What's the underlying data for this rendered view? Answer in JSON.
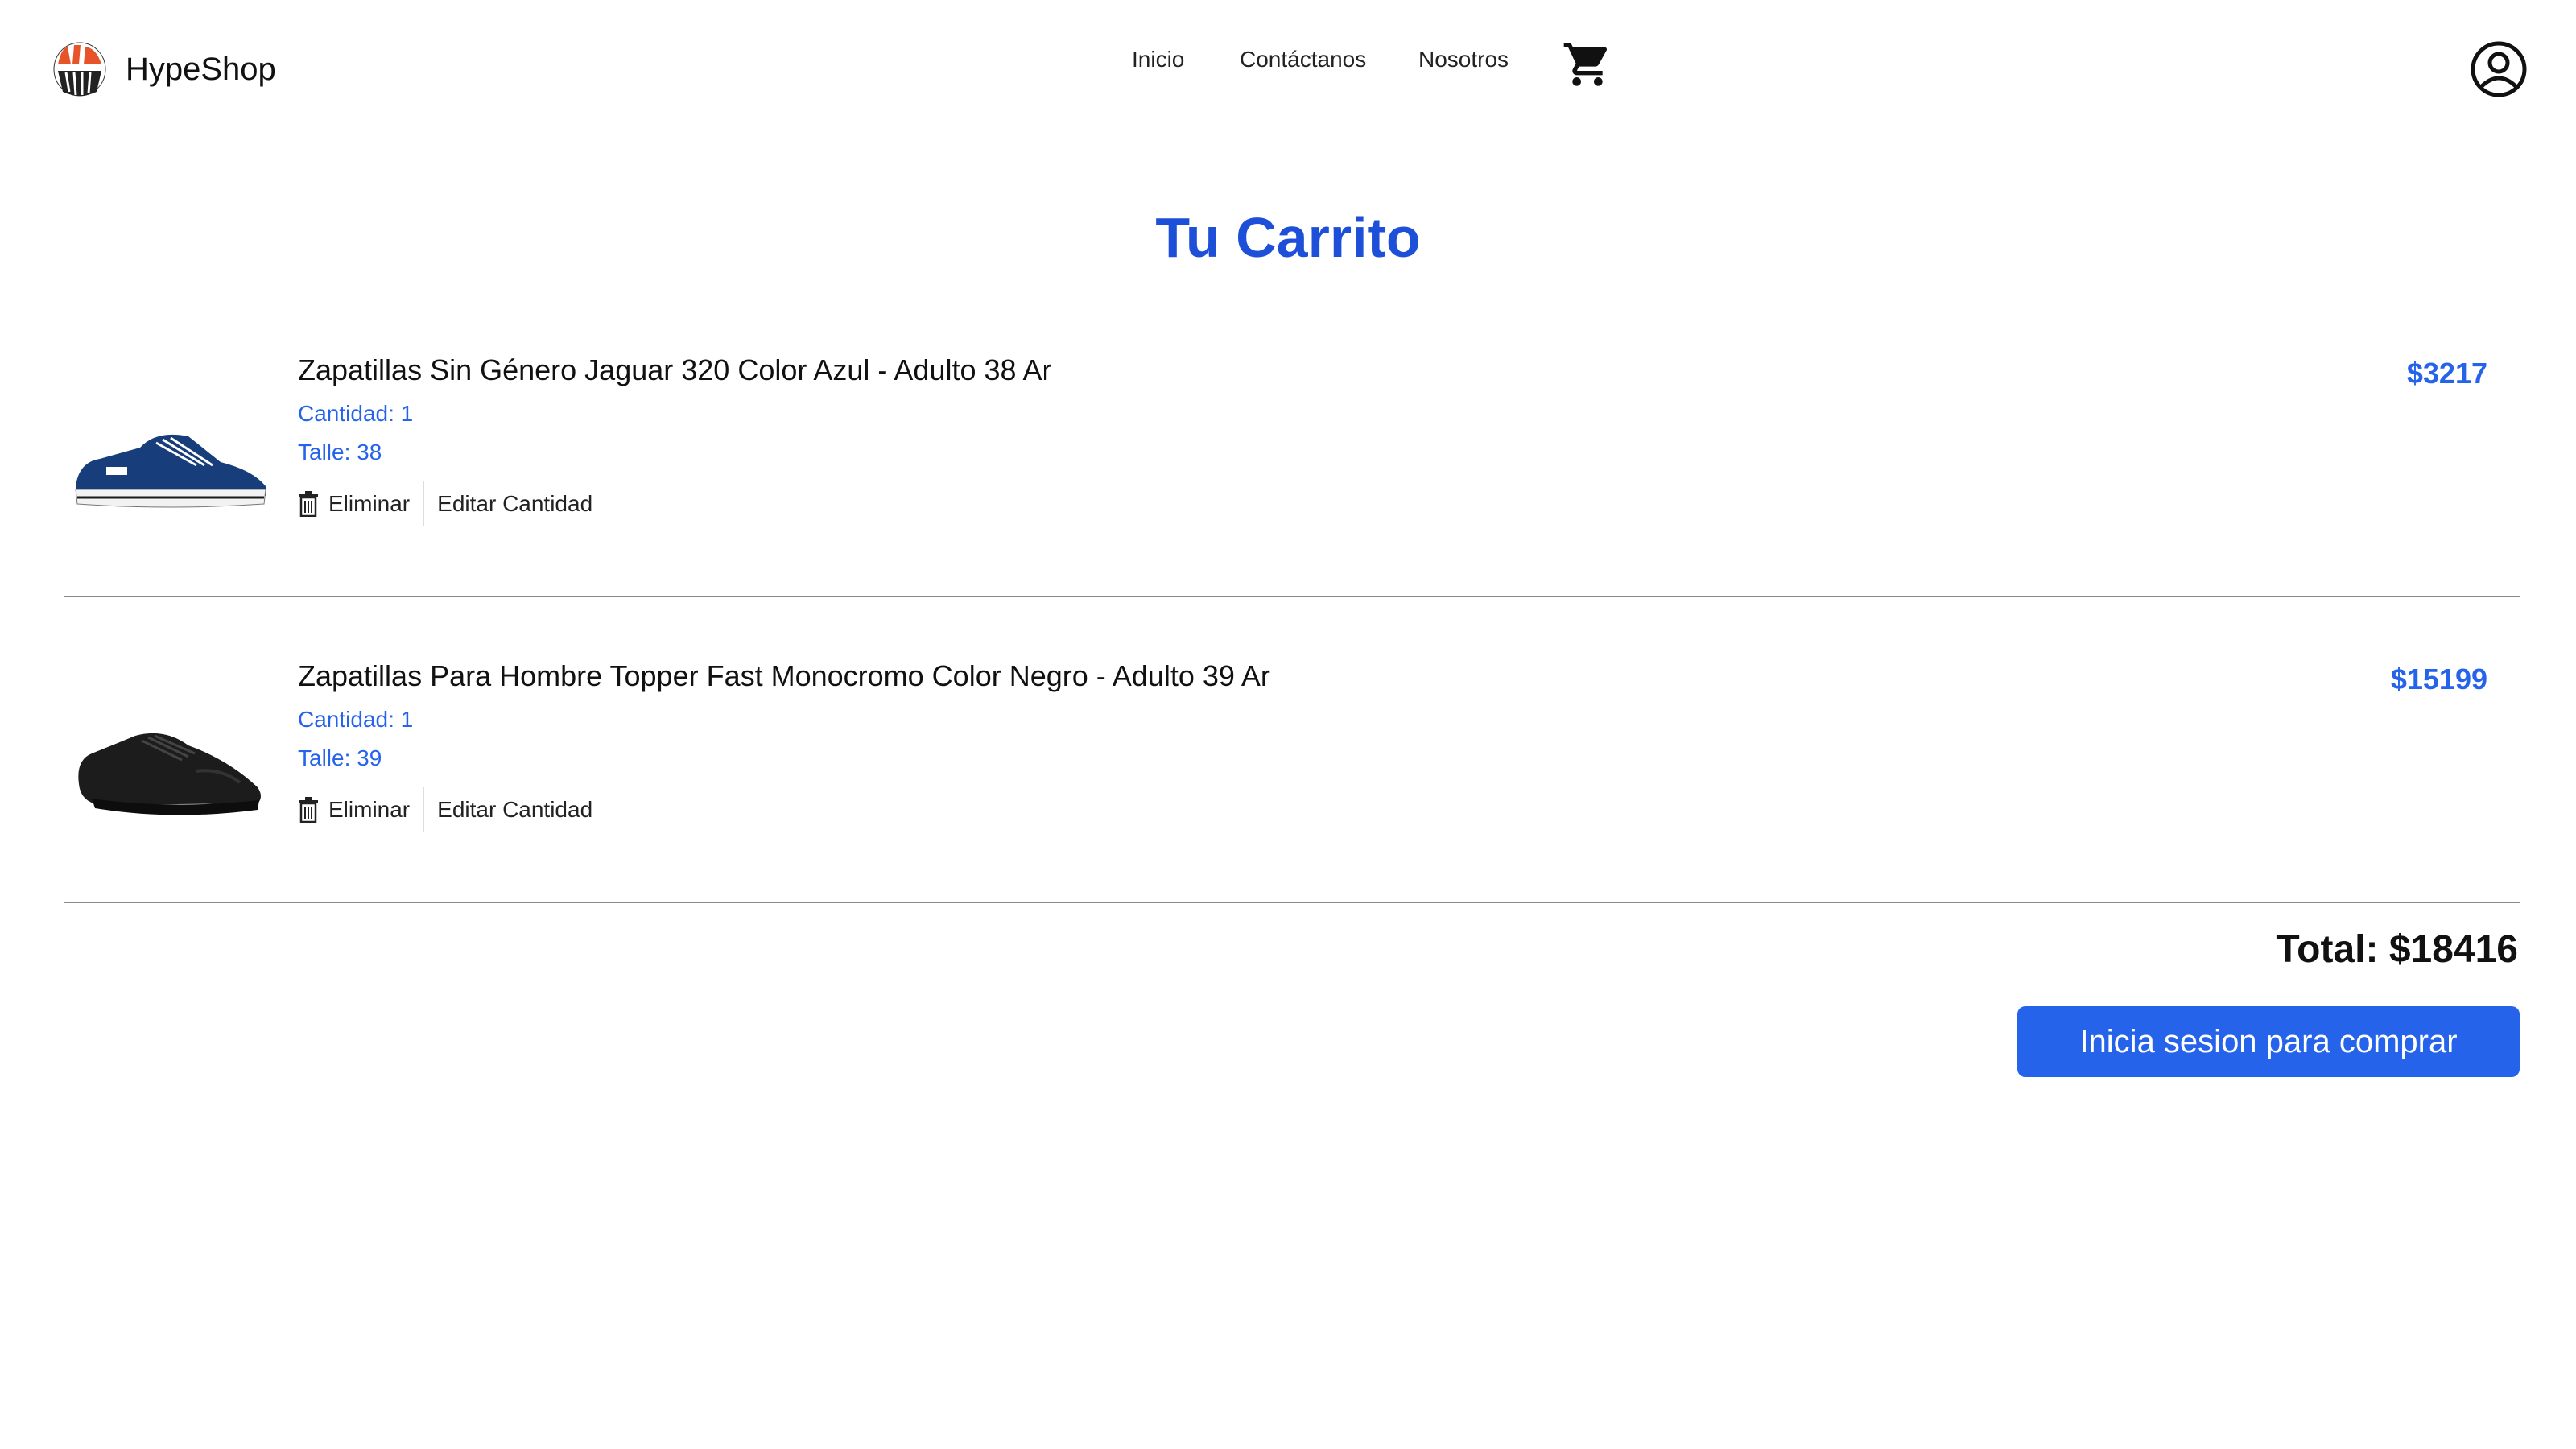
{
  "header": {
    "brand": "HypeShop",
    "nav": [
      "Inicio",
      "Contáctanos",
      "Nosotros"
    ],
    "icons": {
      "logo": "hypeshop-logo",
      "cart": "cart-icon",
      "user": "user-circle-icon"
    }
  },
  "page": {
    "title": "Tu Carrito"
  },
  "cart": {
    "items": [
      {
        "name": "Zapatillas Sin Género Jaguar 320 Color Azul - Adulto 38 Ar",
        "quantity": "Cantidad: 1",
        "size": "Talle: 38",
        "price": "$3217",
        "remove_label": "Eliminar",
        "edit_label": "Editar Cantidad",
        "image": "blue-sneaker"
      },
      {
        "name": "Zapatillas Para Hombre Topper Fast Monocromo Color Negro - Adulto 39 Ar",
        "quantity": "Cantidad: 1",
        "size": "Talle: 39",
        "price": "$15199",
        "remove_label": "Eliminar",
        "edit_label": "Editar Cantidad",
        "image": "black-sneaker"
      }
    ],
    "total": "Total: $18416",
    "checkout_label": "Inicia sesion para comprar"
  },
  "colors": {
    "accent": "#2563eb",
    "title": "#1e4fd8",
    "text": "#111111"
  }
}
